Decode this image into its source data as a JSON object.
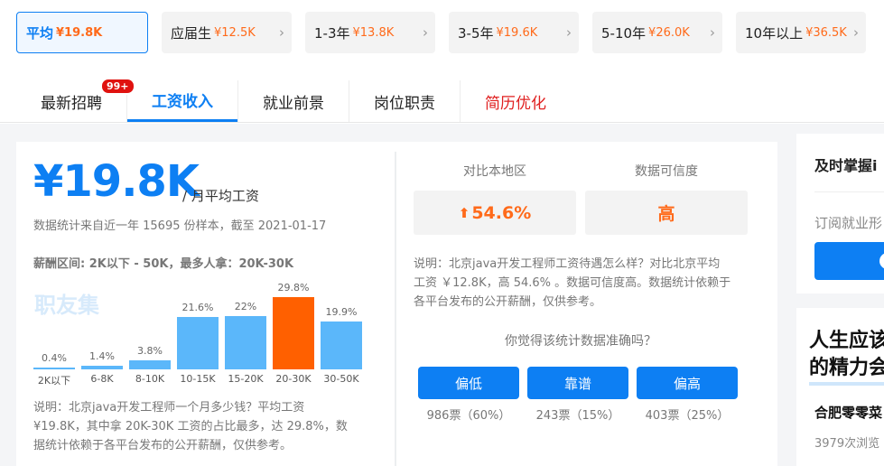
{
  "exp_tabs": [
    {
      "label": "平均",
      "salary": "¥19.8K",
      "active": true
    },
    {
      "label": "应届生",
      "salary": "¥12.5K"
    },
    {
      "label": "1-3年",
      "salary": "¥13.8K"
    },
    {
      "label": "3-5年",
      "salary": "¥19.6K"
    },
    {
      "label": "5-10年",
      "salary": "¥26.0K"
    },
    {
      "label": "10年以上",
      "salary": "¥36.5K"
    }
  ],
  "nav": {
    "items": [
      "最新招聘",
      "工资收入",
      "就业前景",
      "岗位职责",
      "简历优化"
    ],
    "badge": "99+"
  },
  "summary": {
    "salary": "¥19.8K",
    "salary_unit": "/ 月平均工资",
    "stats_note": "数据统计来自近一年 15695 份样本，截至 2021-01-17",
    "range": "薪酬区间: 2K以下 - 50K，最多人拿：20K-30K",
    "watermark": "职友集",
    "description_1": "说明：北京java开发工程师一个月多少钱？平均工资",
    "description_2": "¥19.8K，其中拿 20K-30K 工资的占比最多，达 29.8%，数",
    "description_3": "据统计依赖于各平台发布的公开薪酬，仅供参考。"
  },
  "chart_data": {
    "type": "bar",
    "categories": [
      "2K以下",
      "6-8K",
      "8-10K",
      "10-15K",
      "15-20K",
      "20-30K",
      "30-50K"
    ],
    "values": [
      0.4,
      1.4,
      3.8,
      21.6,
      22,
      29.8,
      19.9
    ],
    "value_labels": [
      "0.4%",
      "1.4%",
      "3.8%",
      "21.6%",
      "22%",
      "29.8%",
      "19.9%"
    ],
    "highlight_index": 5,
    "colors": {
      "normal": "#5bb7fa",
      "highlight": "#ff6000"
    }
  },
  "compare": {
    "col1_title": "对比本地区",
    "col2_title": "数据可信度",
    "col1_value": "54.6%",
    "col2_value": "高",
    "description_1": "说明：北京java开发工程师工资待遇怎么样？对比北京平均",
    "description_2": "工资 ￥12.8K，高 54.6% 。数据可信度高。数据统计依赖于",
    "description_3": "各平台发布的公开薪酬，仅供参考。",
    "question": "你觉得该统计数据准确吗？",
    "votes": [
      {
        "label": "偏低",
        "count": "986票（60%）"
      },
      {
        "label": "靠谱",
        "count": "243票（15%）"
      },
      {
        "label": "偏高",
        "count": "403票（25%）"
      }
    ]
  },
  "sidebar": {
    "subscribe_title": "及时掌握i",
    "subscribe_text": "订阅就业形",
    "promo_title_1": "人生应该",
    "promo_title_2": "的精力会",
    "promo_item": "合肥零零菜",
    "promo_views": "3979次浏览"
  },
  "colors": {
    "accent": "#0d7ff3",
    "orange": "#ff6a1a",
    "red": "#e02020"
  }
}
